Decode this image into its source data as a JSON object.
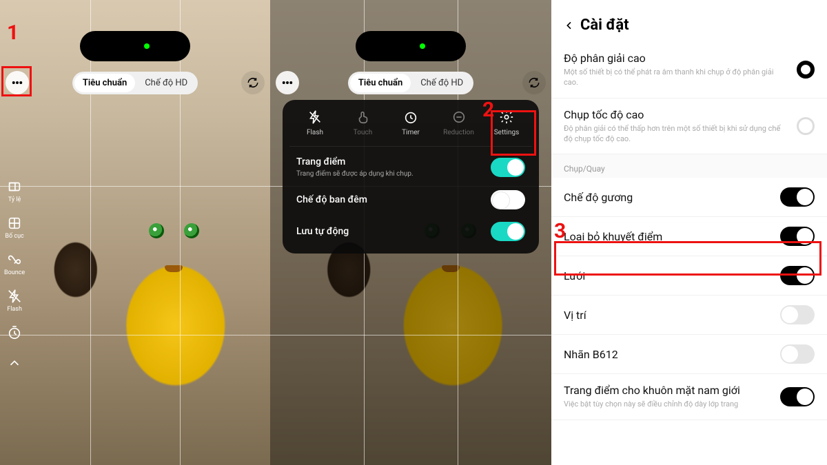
{
  "callouts": {
    "n1": "1",
    "n2": "2",
    "n3": "3"
  },
  "topbar": {
    "seg_standard": "Tiêu chuẩn",
    "seg_hd": "Chế độ HD"
  },
  "sidetools": {
    "ratio": "Tỷ lệ",
    "layout": "Bố cục",
    "bounce": "Bounce",
    "flash": "Flash"
  },
  "overlay": {
    "row1": {
      "flash": "Flash",
      "touch": "Touch",
      "timer": "Timer",
      "reduction": "Reduction",
      "settings": "Settings"
    },
    "makeup_title": "Trang điểm",
    "makeup_sub": "Trang điểm sẽ được áp dụng khi chụp.",
    "night_title": "Chế độ ban đêm",
    "autosave_title": "Lưu tự động"
  },
  "settings": {
    "header": "Cài đặt",
    "hires_title": "Độ phân giải cao",
    "hires_desc": "Một số thiết bị có thể phát ra âm thanh khi chụp ở độ phân giải cao.",
    "hispeed_title": "Chụp tốc độ cao",
    "hispeed_desc": "Độ phân giải có thể thấp hơn trên một số thiết bị khi sử dụng chế độ chụp tốc độ cao.",
    "section_capture": "Chụp/Quay",
    "mirror_title": "Chế độ gương",
    "blemish_title": "Loại bỏ khuyết điểm",
    "grid_title": "Lưới",
    "location_title": "Vị trí",
    "watermark_title": "Nhãn B612",
    "male_makeup_title": "Trang điểm cho khuôn mặt nam giới",
    "male_makeup_desc": "Việc bật tùy chọn này sẽ điều chỉnh độ dày lớp trang"
  }
}
